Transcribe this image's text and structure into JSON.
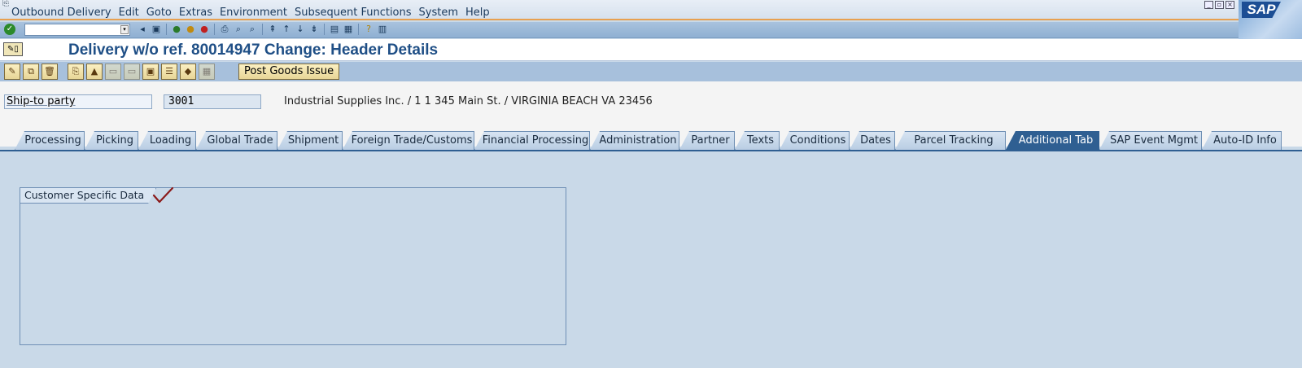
{
  "menu": {
    "items": [
      "Outbound Delivery",
      "Edit",
      "Goto",
      "Extras",
      "Environment",
      "Subsequent Functions",
      "System",
      "Help"
    ]
  },
  "branding": {
    "logo_text": "SAP"
  },
  "title": "Delivery w/o ref. 80014947 Change: Header Details",
  "app_toolbar": {
    "post_goods_issue": "Post Goods Issue"
  },
  "header": {
    "ship_to_label": "Ship-to party",
    "ship_to_value": "3001",
    "ship_to_description": "Industrial Supplies Inc. / 1 1 345 Main St. / VIRGINIA BEACH VA 23456"
  },
  "tabs": [
    {
      "label": "Processing"
    },
    {
      "label": "Picking"
    },
    {
      "label": "Loading"
    },
    {
      "label": "Global Trade"
    },
    {
      "label": "Shipment"
    },
    {
      "label": "Foreign Trade/Customs"
    },
    {
      "label": "Financial Processing"
    },
    {
      "label": "Administration"
    },
    {
      "label": "Partner"
    },
    {
      "label": "Texts"
    },
    {
      "label": "Conditions"
    },
    {
      "label": "Dates"
    },
    {
      "label": "Parcel Tracking"
    },
    {
      "label": "Additional Tab",
      "active": true
    },
    {
      "label": "SAP Event Mgmt"
    },
    {
      "label": "Auto-ID Info"
    }
  ],
  "content": {
    "group_title": "Customer Specific Data"
  },
  "colors": {
    "title_text": "#1f4f86",
    "active_tab": "#2f5f92",
    "pane_bg": "#c9d9e8",
    "annotation_check": "#8b1a1a"
  }
}
